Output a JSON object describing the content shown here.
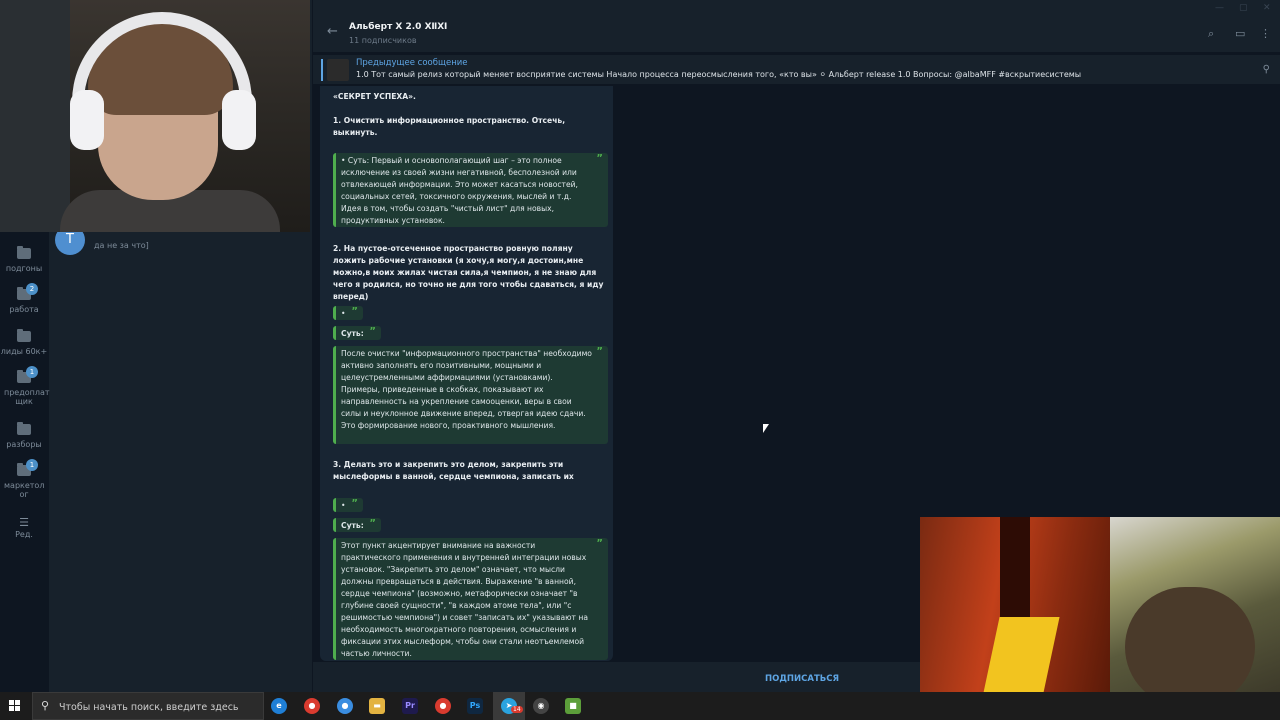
{
  "header": {
    "title": "Альберт X 2.0 ⅫⅪ",
    "subscribers": "11 подписчиков"
  },
  "pinned": {
    "title": "Предыдущее сообщение",
    "text": "1.0  Тот самый релиз который меняет восприятие системы  Начало процесса переосмысления того, «кто вы» ⚪  Альберт release 1.0  Вопросы: @albaMFF  #вскрытиесистемы"
  },
  "chatlist": {
    "avatar_letter": "T",
    "preview": "да не за что]"
  },
  "folders": [
    {
      "label": "подгоны",
      "badge": ""
    },
    {
      "label": "работа",
      "badge": "2"
    },
    {
      "label": "лиды 60к+",
      "badge": ""
    },
    {
      "label": "предоплат щик",
      "badge": "1"
    },
    {
      "label": "разборы",
      "badge": ""
    },
    {
      "label": "маркетол ог",
      "badge": "1"
    },
    {
      "label": "Ред.",
      "badge": ""
    }
  ],
  "message": {
    "heading": "«СЕКРЕТ УСПЕХА».",
    "p1": "1. Очистить информационное пространство. Отсечь, выкинуть.",
    "q1": "• Суть: Первый и основополагающий шаг – это полное исключение из своей жизни негативной, бесполезной или отвлекающей информации. Это может касаться новостей, социальных сетей, токсичного окружения, мыслей и т.д. Идея в том, чтобы создать \"чистый лист\" для новых, продуктивных установок.",
    "p2": "2. На пустое-отсеченное пространство ровную поляну ложить рабочие установки (я хочу,я могу,я достоин,мне можно,в моих жилах чистая сила,я чемпион, я не знаю для чего я родился, но точно не для того чтобы сдаваться, я иду вперед)",
    "q2a": "•",
    "label_sut": "Суть:",
    "q2": "После очистки \"информационного пространства\" необходимо активно заполнять его позитивными, мощными и целеустремленными аффирмациями (установками). Примеры, приведенные в скобках, показывают их направленность на укрепление самооценки, веры в свои силы и неуклонное движение вперед, отвергая идею сдачи. Это формирование нового, проактивного мышления.",
    "p3": "3. Делать это и закрепить это делом, закрепить эти мыслеформы в ванной, сердце чемпиона, записать их",
    "q3a": "•",
    "q3": "Этот пункт акцентирует внимание на важности практического применения и внутренней интеграции новых установок. \"Закрепить это делом\" означает, что мысли должны превращаться в действия. Выражение \"в ванной, сердце чемпиона\" (возможно, метафорически означает \"в глубине своей сущности\", \"в каждом атоме тела\", или \"с решимостью чемпиона\") и совет \"записать их\" указывают на необходимость многократного повторения, осмысления и фиксации этих мыслеформ, чтобы они стали неотъемлемой частью личности."
  },
  "subscribe_label": "ПОДПИСАТЬСЯ",
  "taskbar": {
    "search_placeholder": "Чтобы начать поиск, введите здесь",
    "telegram_badge": "14"
  },
  "colors": {
    "accent": "#5ea5e4",
    "quote_border": "#4fae4e",
    "bg": "#0e1621",
    "panel": "#17212b"
  }
}
